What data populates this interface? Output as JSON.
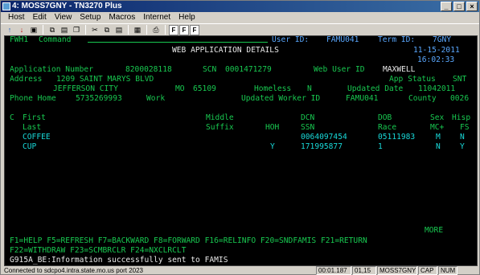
{
  "window": {
    "title": "4: MOSS7GNY - TN3270 Plus",
    "min_glyph": "_",
    "max_glyph": "□",
    "close_glyph": "×"
  },
  "menu": [
    "Host",
    "Edit",
    "View",
    "Setup",
    "Macros",
    "Internet",
    "Help"
  ],
  "toolbar": {
    "up_glyph": "↑",
    "down_glyph": "↓",
    "save_glyph": "▣",
    "copy_glyph": "⧉",
    "paste_glyph": "▤",
    "cut_glyph": "✂",
    "glyph_3": "❐",
    "glyph_4": "▦",
    "print_glyph": "⎙",
    "font_labels": [
      "F",
      "F",
      "F"
    ]
  },
  "terminal": {
    "row1": {
      "screen_id": "FWH1",
      "command_label": "Command",
      "user_label": "User ID:",
      "user_value": "FAMU041",
      "term_label": "Term ID:",
      "term_value": "7GNY"
    },
    "row2": {
      "title": "WEB APPLICATION DETAILS",
      "date": "11-15-2011"
    },
    "row3": {
      "time": "16:02:33"
    },
    "row4": {
      "app_label": "Application Number",
      "app_value": "8200028118",
      "scn_label": "SCN",
      "scn_value": "0001471279",
      "web_user_label": "Web User ID",
      "web_user_value": "MAXWELL"
    },
    "row5": {
      "address_label": "Address",
      "address_value": "1209 SAINT MARYS BLVD",
      "status_label": "App Status",
      "status_value": "SNT"
    },
    "row6": {
      "city": "JEFFERSON CITY",
      "state": "MO",
      "zip": "65109",
      "homeless_label": "Homeless",
      "homeless_value": "N",
      "updated_date_label": "Updated Date",
      "updated_date_value": "11042011"
    },
    "row7": {
      "phone_label": "Phone Home",
      "phone_value": "5735269993",
      "work_label": "Work",
      "updated_worker_label": "Updated Worker ID",
      "updated_worker_value": "FAMU041",
      "county_label": "County",
      "county_value": "0026"
    },
    "headers1": {
      "c": "C",
      "first": "First",
      "middle": "Middle",
      "dcn": "DCN",
      "dob": "DOB",
      "sex": "Sex",
      "hisp": "Hisp"
    },
    "headers2": {
      "last": "Last",
      "suffix": "Suffix",
      "hoh": "HOH",
      "ssn": "SSN",
      "race": "Race",
      "mc": "MC+",
      "fs": "FS"
    },
    "members": [
      {
        "first": "COFFEE",
        "hoh": "",
        "dcn": "0064097454",
        "dob": "05111983",
        "sex": "M",
        "hisp": "N"
      },
      {
        "first": "CUP",
        "hoh": "Y",
        "dcn": "171995877",
        "dob": "1",
        "sex": "N",
        "hisp": "Y"
      }
    ],
    "more": "MORE",
    "keys1": "F1=HELP F5=REFRESH F7=BACKWARD F8=FORWARD F16=RELINFO F20=SNDFAMIS F21=RETURN",
    "keys2": "F22=WITHDRAW F23=SCMBRCLR F24=NXCLRCLT",
    "message": "G915A_BE:Information successfully sent to FAMIS"
  },
  "status": {
    "connection": "Connected to sdcpo4.intra.state.mo.us port 2023",
    "elapsed": "00:01.187",
    "cursor": "01,15",
    "session": "MOSS7GNY",
    "cap": "CAP",
    "num": "NUM"
  }
}
